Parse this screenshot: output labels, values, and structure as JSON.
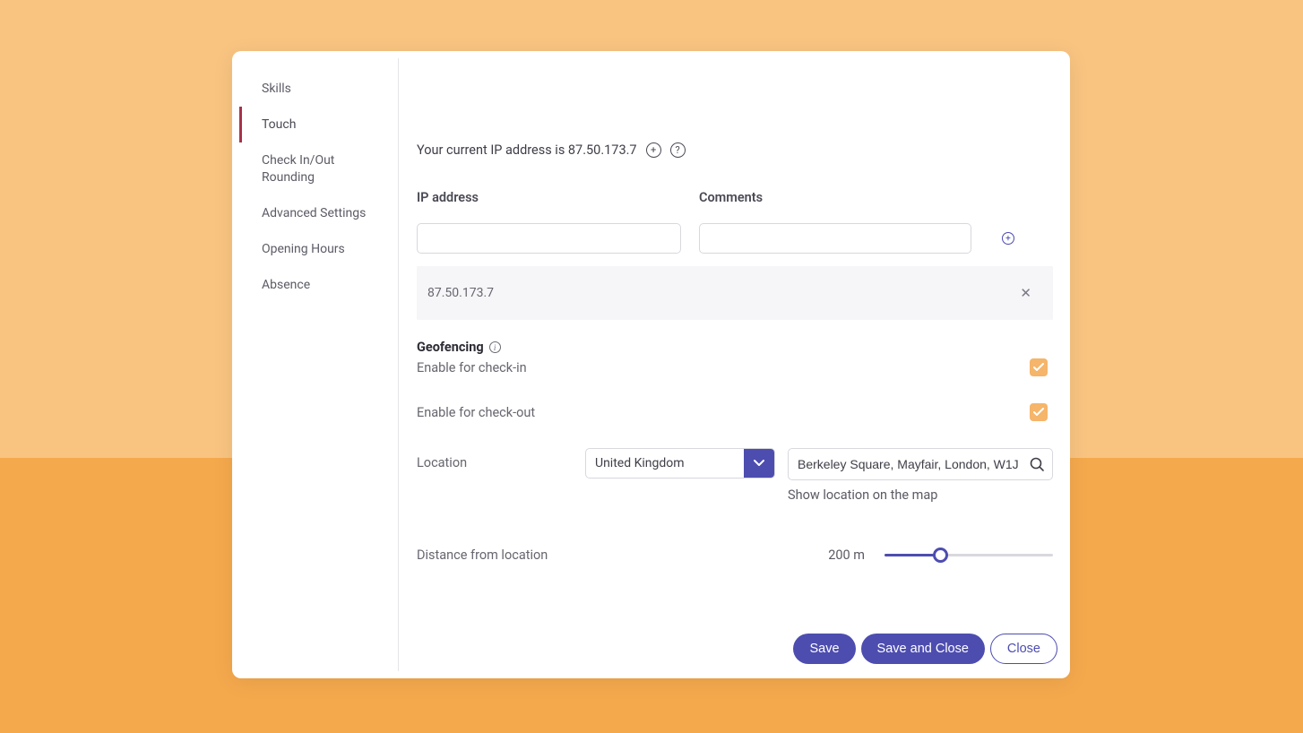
{
  "sidebar": {
    "items": [
      {
        "label": "Skills",
        "active": false
      },
      {
        "label": "Touch",
        "active": true
      },
      {
        "label": "Check In/Out Rounding",
        "active": false
      },
      {
        "label": "Advanced Settings",
        "active": false
      },
      {
        "label": "Opening Hours",
        "active": false
      },
      {
        "label": "Absence",
        "active": false
      }
    ]
  },
  "ip": {
    "current_text": "Your current IP address is 87.50.173.7",
    "header_ip": "IP address",
    "header_comments": "Comments",
    "entries": [
      {
        "value": "87.50.173.7"
      }
    ]
  },
  "geofencing": {
    "title": "Geofencing",
    "enable_checkin_label": "Enable for check-in",
    "enable_checkin": true,
    "enable_checkout_label": "Enable for check-out",
    "enable_checkout": true,
    "location_label": "Location",
    "country": "United Kingdom",
    "address": "Berkeley Square, Mayfair, London, W1J",
    "show_map_label": "Show location on the map",
    "distance_label": "Distance from location",
    "distance_value": "200 m"
  },
  "footer": {
    "save": "Save",
    "save_close": "Save and Close",
    "close": "Close"
  }
}
